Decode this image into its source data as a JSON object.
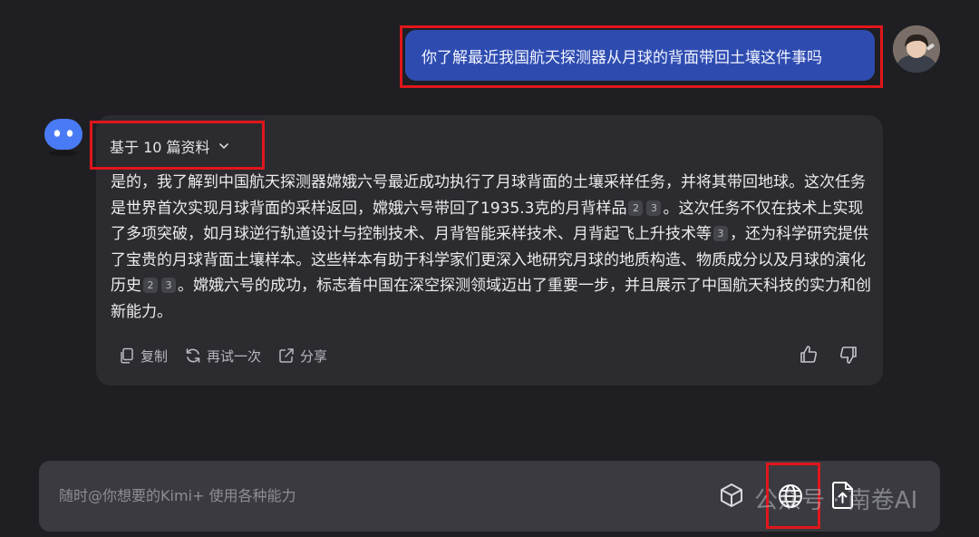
{
  "user_message": {
    "text": "你了解最近我国航天探测器从月球的背面带回土壤这件事吗"
  },
  "assistant": {
    "sources_label": "基于 10 篇资料",
    "answer_segments": [
      {
        "type": "text",
        "value": "是的，我了解到中国航天探测器嫦娥六号最近成功执行了月球背面的土壤采样任务，并将其带回地球。这次任务是世界首次实现月球背面的采样返回，嫦娥六号带回了1935.3克的月背样品"
      },
      {
        "type": "ref",
        "value": "2"
      },
      {
        "type": "ref",
        "value": "3"
      },
      {
        "type": "text",
        "value": "。这次任务不仅在技术上实现了多项突破，如月球逆行轨道设计与控制技术、月背智能采样技术、月背起飞上升技术等"
      },
      {
        "type": "ref",
        "value": "3"
      },
      {
        "type": "text",
        "value": "，还为科学研究提供了宝贵的月球背面土壤样本。这些样本有助于科学家们更深入地研究月球的地质构造、物质成分以及月球的演化历史"
      },
      {
        "type": "ref",
        "value": "2"
      },
      {
        "type": "ref",
        "value": "3"
      },
      {
        "type": "text",
        "value": "。嫦娥六号的成功，标志着中国在深空探测领域迈出了重要一步，并且展示了中国航天科技的实力和创新能力。"
      }
    ],
    "actions": {
      "copy": "复制",
      "retry": "再试一次",
      "share": "分享"
    }
  },
  "input": {
    "placeholder": "随时@你想要的Kimi+ 使用各种能力"
  },
  "watermark": {
    "text": "公众号 · 南卷AI"
  },
  "colors": {
    "user_bubble": "#2e4cb0",
    "annotation_box": "#e0161b",
    "card_bg": "#2b2b30"
  }
}
